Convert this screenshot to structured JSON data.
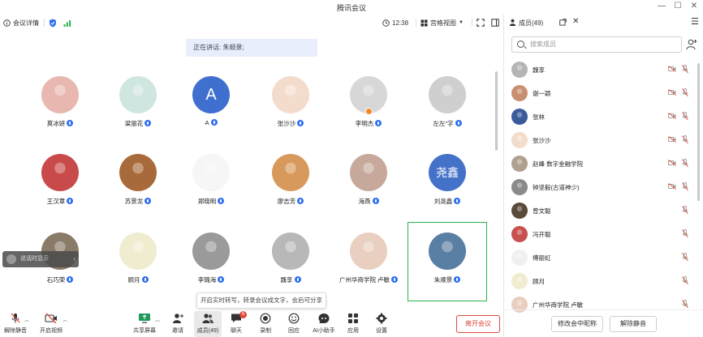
{
  "window": {
    "title": "腾讯会议"
  },
  "toolbar": {
    "meeting_info": "会议详情",
    "time": "12:38",
    "view_label": "宫格视图"
  },
  "speaking": {
    "text": "正在讲话: 朱顺景;"
  },
  "grid": {
    "tiles": [
      {
        "name": "莫冰妍",
        "avatar": "photo",
        "color": "#e8b8b0"
      },
      {
        "name": "梁丽花",
        "avatar": "photo",
        "color": "#cfe6e0"
      },
      {
        "name": "A",
        "avatar": "letter",
        "letter": "A"
      },
      {
        "name": "张沙沙",
        "avatar": "photo",
        "color": "#f4dccd"
      },
      {
        "name": "李明杰",
        "avatar": "photo",
        "color": "#d7d7d7",
        "host": true
      },
      {
        "name": "左左\"字",
        "avatar": "photo",
        "color": "#cfcfcf"
      },
      {
        "name": "王汉章",
        "avatar": "photo",
        "color": "#c84a4a"
      },
      {
        "name": "苏景龙",
        "avatar": "photo",
        "color": "#a86a3a"
      },
      {
        "name": "郑晓明",
        "avatar": "photo",
        "color": "#f6f6f6"
      },
      {
        "name": "廖志芳",
        "avatar": "photo",
        "color": "#d89a5c"
      },
      {
        "name": "海燕",
        "avatar": "photo",
        "color": "#c6a99a"
      },
      {
        "name": "刘尧鑫",
        "avatar": "cn",
        "letter": "尧鑫"
      },
      {
        "name": "石巧荣",
        "avatar": "photo",
        "color": "#8a7a68"
      },
      {
        "name": "顾月",
        "avatar": "photo",
        "color": "#f0ecd0"
      },
      {
        "name": "李璐海",
        "avatar": "photo",
        "color": "#9a9a9a"
      },
      {
        "name": "魏享",
        "avatar": "photo",
        "color": "#b8b8b8"
      },
      {
        "name": "广州华商学院 卢敏",
        "avatar": "photo",
        "color": "#e8cfc0"
      },
      {
        "name": "朱顺景",
        "avatar": "photo",
        "color": "#5a7fa4",
        "selected": true
      }
    ]
  },
  "caption_tip": {
    "text": "说话时显示"
  },
  "hint_tip": {
    "text": "开启实时转写，转录会议成文字，会后可分享"
  },
  "bottombar": {
    "unmute": "解除静音",
    "video": "开启视频",
    "share": "共享屏幕",
    "invite": "邀请",
    "members": "成员(49)",
    "chat": "聊天",
    "chat_badge": "6",
    "record": "录制",
    "react": "回应",
    "ai": "AI小助手",
    "apps": "应用",
    "settings": "设置",
    "leave": "离开会议"
  },
  "panel": {
    "title": "成员(49)",
    "search_placeholder": "搜索成员",
    "members": [
      {
        "name": "魏享",
        "color": "#b5b5b5"
      },
      {
        "name": "谢一颖",
        "color": "#c89070"
      },
      {
        "name": "张林",
        "color": "#3a5a9a"
      },
      {
        "name": "张沙沙",
        "color": "#f4dccd"
      },
      {
        "name": "赵峰 数字金融学院",
        "color": "#b0a090"
      },
      {
        "name": "钟坚毅(古道神少)",
        "color": "#8a8a8a"
      },
      {
        "name": "曾文聪",
        "color": "#5a4a3a"
      },
      {
        "name": "冯开聪",
        "color": "#c85050"
      },
      {
        "name": "傅丽虹",
        "color": "#f0f0f0"
      },
      {
        "name": "顾月",
        "color": "#f0ecd0"
      },
      {
        "name": "广州华商学院 卢敏",
        "color": "#e8cfc0"
      }
    ],
    "rename_button": "修改会中昵称",
    "unmute_button": "解除静音"
  }
}
